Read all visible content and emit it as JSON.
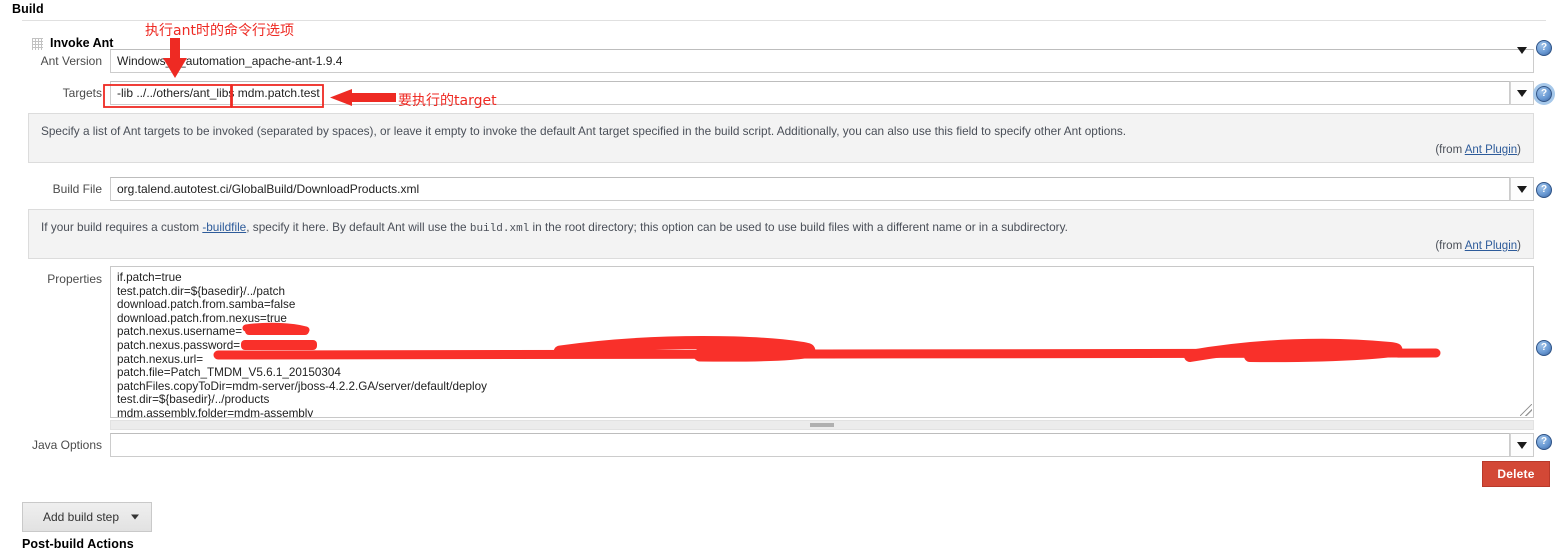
{
  "sections": {
    "build_title": "Build",
    "postbuild_title": "Post-build Actions"
  },
  "block": {
    "title": "Invoke Ant",
    "grip_icon": "drag-grip-icon"
  },
  "fields": {
    "ant_version": {
      "label": "Ant Version",
      "value": "Windows_4_automation_apache-ant-1.9.4",
      "caret_icon": "chevron-down-icon"
    },
    "targets": {
      "label": "Targets",
      "value": "-lib ../../others/ant_libs mdm.patch.test",
      "caret_icon": "chevron-down-icon",
      "help": {
        "text_before": "Specify a list of Ant targets to be invoked (separated by spaces), or leave it empty to invoke the default Ant target specified in the build script. Additionally, you can also use this field to specify other Ant options.",
        "from_prefix": "(from ",
        "from_link": "Ant Plugin",
        "from_suffix": ")"
      }
    },
    "build_file": {
      "label": "Build File",
      "value": "org.talend.autotest.ci/GlobalBuild/DownloadProducts.xml",
      "caret_icon": "chevron-down-icon",
      "help": {
        "part1": "If your build requires a custom ",
        "link1": "-buildfile",
        "part2": ", specify it here. By default Ant will use the ",
        "code1": "build.xml",
        "part3": " in the root directory; this option can be used to use build files with a different name or in a subdirectory.",
        "from_prefix": "(from ",
        "from_link": "Ant Plugin",
        "from_suffix": ")"
      }
    },
    "properties": {
      "label": "Properties",
      "lines": [
        "if.patch=true",
        "test.patch.dir=${basedir}/../patch",
        "download.patch.from.samba=false",
        "download.patch.from.nexus=true",
        "patch.nexus.username=",
        "patch.nexus.password=",
        "patch.nexus.url=",
        "patch.file=Patch_TMDM_V5.6.1_20150304",
        "patchFiles.copyToDir=mdm-server/jboss-4.2.2.GA/server/default/deploy",
        "test.dir=${basedir}/../products",
        "mdm.assembly.folder=mdm-assembly"
      ],
      "resize_icon": "resize-grip-icon"
    },
    "java_options": {
      "label": "Java Options",
      "value": "",
      "caret_icon": "chevron-down-icon"
    }
  },
  "buttons": {
    "delete": "Delete",
    "add_build_step": "Add build step",
    "add_build_step_caret": "chevron-down-icon"
  },
  "help_icons": {
    "glyph": "?",
    "name": "help-icon"
  },
  "annotations": [
    {
      "text": "执行ant时的命令行选项",
      "name": "annotation-command-line-options"
    },
    {
      "text": "要执行的target",
      "name": "annotation-target-to-run"
    }
  ],
  "colors": {
    "annotation_red": "#ee2a23",
    "redaction_red": "#f9302a",
    "delete_button": "#d34836",
    "link_blue": "#2d5b9a",
    "blurb_bg": "#f3f3f3"
  }
}
